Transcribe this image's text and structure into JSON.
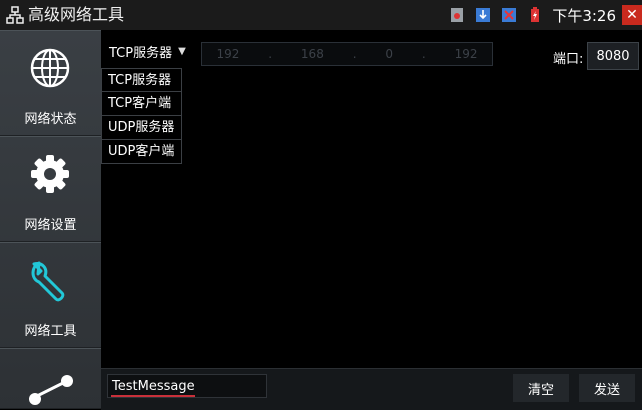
{
  "window": {
    "title": "高级网络工具",
    "clock": "下午3:26",
    "close_label": "✕"
  },
  "sidebar": {
    "items": [
      {
        "label": "网络状态"
      },
      {
        "label": "网络设置"
      },
      {
        "label": "网络工具"
      }
    ]
  },
  "toolbar": {
    "mode_selected": "TCP服务器",
    "ip": [
      "192",
      "168",
      "0",
      "192"
    ],
    "port_label": "端口:",
    "port_value": "8080"
  },
  "mode_menu": {
    "options": [
      "TCP服务器",
      "TCP客户端",
      "UDP服务器",
      "UDP客户端"
    ]
  },
  "bottom": {
    "message_value": "TestMessage",
    "clear_label": "清空",
    "send_label": "发送"
  },
  "colors": {
    "accent": "#22c8d8",
    "close": "#c92a1e"
  }
}
